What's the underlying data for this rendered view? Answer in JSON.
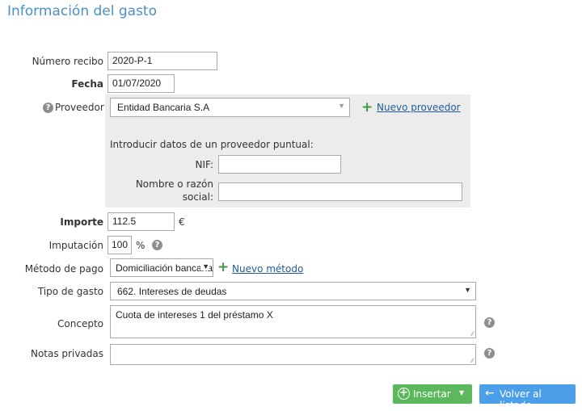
{
  "page": {
    "title": "Información del gasto"
  },
  "form": {
    "numero_recibo": {
      "label": "Número recibo",
      "value": "2020-P-1"
    },
    "fecha": {
      "label": "Fecha",
      "value": "01/07/2020"
    },
    "proveedor": {
      "label": "Proveedor",
      "selected": "Entidad Bancaria S.A",
      "new_link": "Nuevo proveedor",
      "puntual_heading": "Introducir datos de un proveedor puntual:",
      "nif_label": "NIF:",
      "nif_value": "",
      "nombre_label_line1": "Nombre o razón",
      "nombre_label_line2": "social:",
      "nombre_value": ""
    },
    "importe": {
      "label": "Importe",
      "value": "112.5",
      "unit": "€"
    },
    "imputacion": {
      "label": "Imputación",
      "value": "100",
      "unit": "%"
    },
    "metodo_pago": {
      "label": "Método de pago",
      "selected": "Domiciliación bancaria",
      "new_link": "Nuevo método"
    },
    "tipo_gasto": {
      "label": "Tipo de gasto",
      "selected": "662. Intereses de deudas"
    },
    "concepto": {
      "label": "Concepto",
      "value": "Cuota de intereses 1 del préstamo X"
    },
    "notas": {
      "label": "Notas privadas",
      "value": ""
    }
  },
  "actions": {
    "insert_label": "Insertar",
    "back_label": "Volver al listado"
  },
  "colors": {
    "title": "#4a90c8",
    "insert": "#5cb85c",
    "back": "#4a9fe8",
    "link": "#1f5b9a",
    "plus": "#3e9a3e"
  },
  "icons": [
    "help-icon",
    "plus-icon",
    "dropdown-arrow-icon",
    "plus-circle-icon",
    "arrow-left-icon",
    "resize-handle-icon"
  ]
}
